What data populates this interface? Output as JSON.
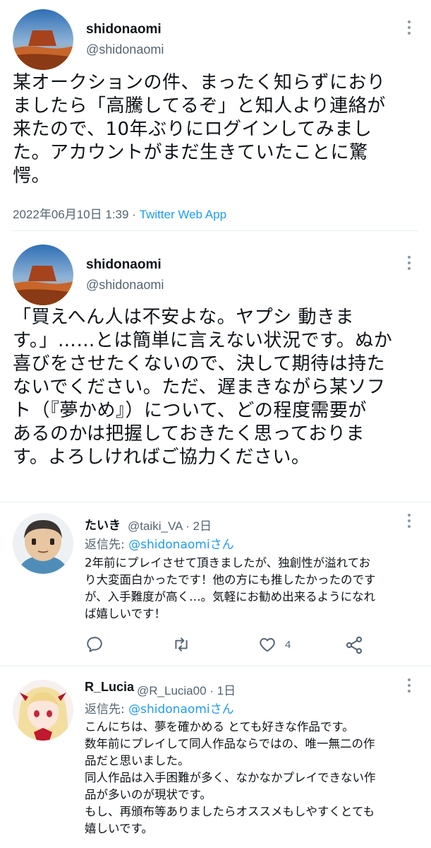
{
  "tweet1": {
    "name": "shidonaomi",
    "handle": "@shidonaomi",
    "avatar": "desert-butte-avatar",
    "lines": [
      "某オークションの件、まったく知らずにおり",
      "ましたら「高騰してるぞ」と知人より連絡が",
      "来たので、10年ぶりにログインしてみまし",
      "た。アカウントがまだ生きていたことに驚",
      "愕。"
    ],
    "timestamp": "2022年06月10日 1:39",
    "separator": " · ",
    "source": "Twitter Web App"
  },
  "tweet2": {
    "name": "shidonaomi",
    "handle": "@shidonaomi",
    "avatar": "desert-butte-avatar",
    "lines": [
      "「買えへん人は不安よな。ヤプシ 動きま",
      "す。」……とは簡単に言えない状況です。ぬか",
      "喜びをさせたくないので、決して期待は持た",
      "ないでください。ただ、遅まきながら某ソフ",
      "ト（『夢かめ』）について、どの程度需要が",
      "あるのかは把握しておきたく思っておりま",
      "す。よろしければご協力ください。"
    ]
  },
  "reply1": {
    "name": "たいき",
    "handle": "@taiki_VA",
    "time": "· 2日",
    "replying_prefix": "返信先: ",
    "replying_user": "@shidonaomiさん",
    "lines": [
      "2年前にプレイさせて頂きましたが、独創性が溢れてお",
      "り大変面白かったです！他の方にも推したかったのです",
      "が、入手難度が高く…。気軽にお勧め出来るようになれ",
      "ば嬉しいです！"
    ],
    "actions": {
      "reply_icon": "reply-icon",
      "retweet_icon": "retweet-icon",
      "like_icon": "heart-icon",
      "like_count": "4",
      "share_icon": "share-icon"
    }
  },
  "reply2": {
    "name": "R_Lucia",
    "handle": "@R_Lucia00",
    "time": "· 1日",
    "replying_prefix": "返信先: ",
    "replying_user": "@shidonaomiさん",
    "lines": [
      "こんにちは、夢を確かめる とても好きな作品です。",
      "数年前にプレイして同人作品ならではの、唯一無二の作",
      "品だと思いました。",
      "同人作品は入手困難が多く、なかなかプレイできない作",
      "品が多いのが現状です。",
      "もし、再頒布等ありましたらオススメもしやすくとても",
      "嬉しいです。"
    ]
  },
  "colors": {
    "text": "#0f1419",
    "secondary": "#536471",
    "link": "#1d9bf0",
    "divider": "#e6ecf0"
  }
}
